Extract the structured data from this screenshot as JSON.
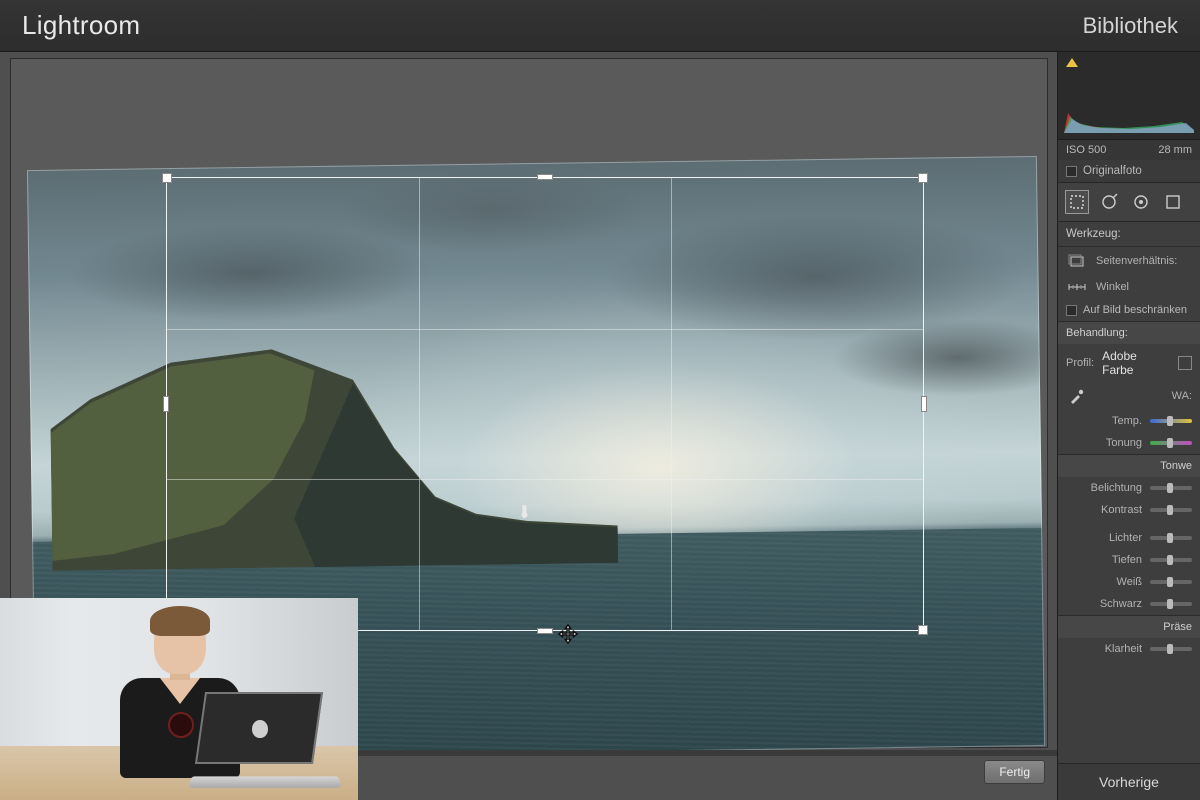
{
  "app": {
    "title": "Lightroom"
  },
  "modules": {
    "library": "Bibliothek"
  },
  "canvas": {
    "done": "Fertig"
  },
  "histogram": {
    "iso_label": "ISO 500",
    "focal": "28 mm",
    "original_label": "Originalfoto"
  },
  "tools": {
    "header": "Werkzeug:",
    "aspect_label": "Seitenverhältnis:",
    "angle_label": "Winkel",
    "constrain_label": "Auf Bild beschränken"
  },
  "basic": {
    "treatment_header": "Behandlung:",
    "profile_label": "Profil:",
    "profile_value": "Adobe Farbe",
    "wb_label": "WA:",
    "temp": "Temp.",
    "tint": "Tonung",
    "tone_header": "Tonwe",
    "exposure": "Belichtung",
    "contrast": "Kontrast",
    "highlights": "Lichter",
    "shadows": "Tiefen",
    "whites": "Weiß",
    "blacks": "Schwarz",
    "presence_header": "Präse",
    "clarity": "Klarheit"
  },
  "footer": {
    "previous": "Vorherige"
  }
}
